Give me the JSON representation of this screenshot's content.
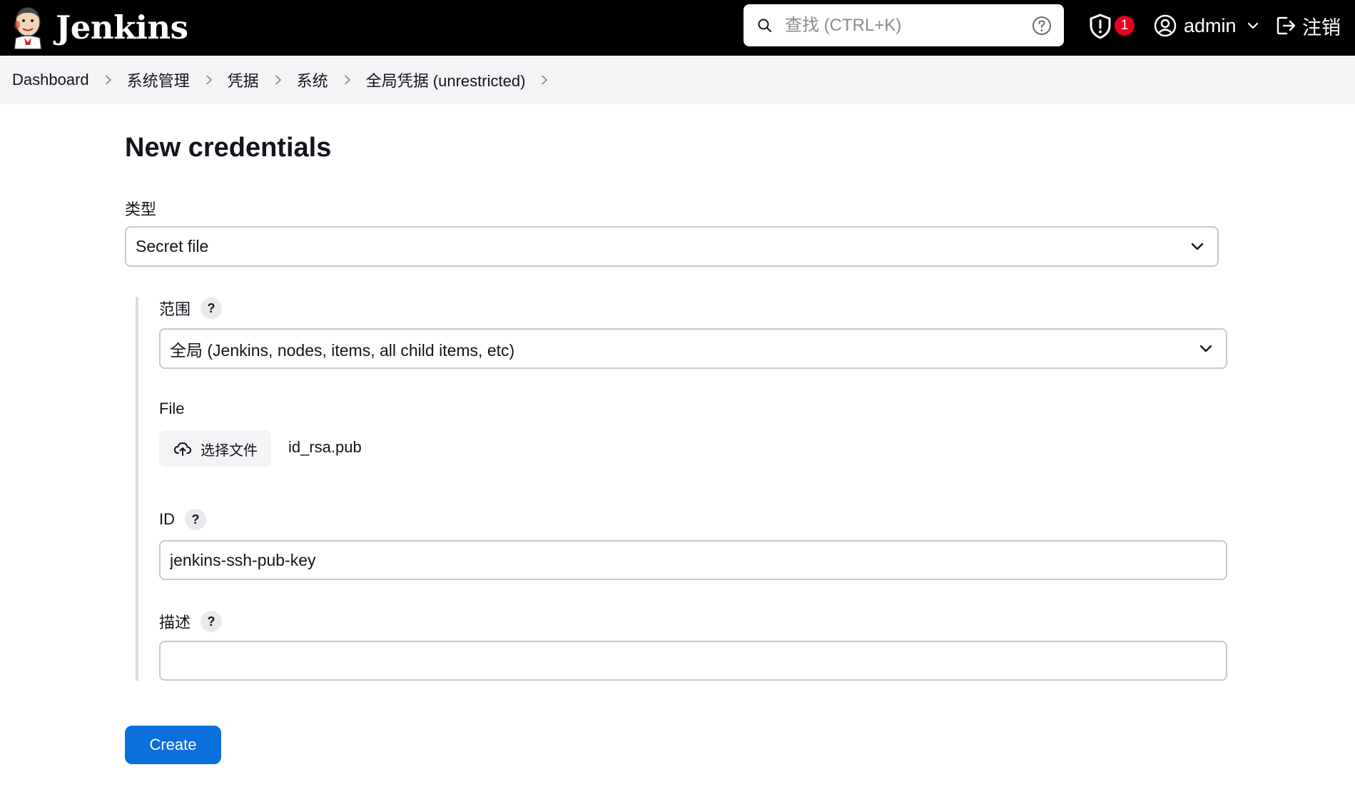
{
  "header": {
    "app_name": "Jenkins",
    "search": {
      "placeholder": "查找 (CTRL+K)",
      "value": ""
    },
    "security_badge_count": "1",
    "user_name": "admin",
    "logout_label": "注销"
  },
  "breadcrumb": [
    "Dashboard",
    "系统管理",
    "凭据",
    "系统",
    "全局凭据 (unrestricted)"
  ],
  "main": {
    "title": "New credentials",
    "type": {
      "label": "类型",
      "value": "Secret file"
    },
    "scope": {
      "label": "范围",
      "help": "?",
      "value": "全局 (Jenkins, nodes, items, all child items, etc)"
    },
    "file": {
      "label": "File",
      "button_label": "选择文件",
      "file_name": "id_rsa.pub"
    },
    "id_field": {
      "label": "ID",
      "help": "?",
      "value": "jenkins-ssh-pub-key"
    },
    "description": {
      "label": "描述",
      "help": "?",
      "value": ""
    },
    "create_label": "Create"
  },
  "colors": {
    "header_bg": "#000000",
    "breadcrumb_bg": "#f4f4f6",
    "primary_button": "#0b6fdc",
    "badge": "#e6001f"
  },
  "icons": [
    "jenkins-logo-icon",
    "search-icon",
    "help-circle-icon",
    "shield-alert-icon",
    "user-circle-icon",
    "chevron-down-icon",
    "logout-icon",
    "chevron-right-icon",
    "upload-cloud-icon"
  ]
}
